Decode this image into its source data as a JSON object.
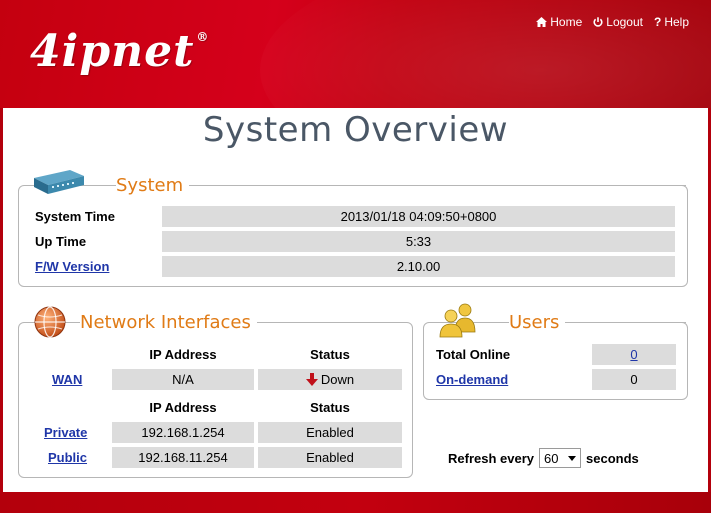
{
  "brand": {
    "logo_text": "4ipnet",
    "logo_mark": "®"
  },
  "topnav": {
    "home": "Home",
    "logout": "Logout",
    "help": "Help"
  },
  "page_title": "System Overview",
  "system": {
    "title": "System",
    "rows": [
      {
        "label": "System Time",
        "value": "2013/01/18 04:09:50+0800"
      },
      {
        "label": "Up Time",
        "value": "5:33"
      },
      {
        "label": "F/W Version",
        "value": "2.10.00"
      }
    ]
  },
  "network": {
    "title": "Network Interfaces",
    "col_ip": "IP Address",
    "col_status": "Status",
    "wan": {
      "label": "WAN",
      "ip": "N/A",
      "status": "Down"
    },
    "col_ip2": "IP Address",
    "col_status2": "Status",
    "private": {
      "label": "Private",
      "ip": "192.168.1.254",
      "status": "Enabled"
    },
    "public": {
      "label": "Public",
      "ip": "192.168.11.254",
      "status": "Enabled"
    }
  },
  "users": {
    "title": "Users",
    "total_online_label": "Total Online",
    "total_online_value": "0",
    "on_demand_label": "On-demand",
    "on_demand_value": "0"
  },
  "refresh": {
    "prefix": "Refresh every",
    "interval": "60",
    "suffix": "seconds"
  },
  "colors": {
    "brand_red": "#c4000f",
    "title_orange": "#e07b16",
    "link_blue": "#1f36a8",
    "cell_gray": "#dcdcdc",
    "down_arrow": "#c0101a"
  }
}
